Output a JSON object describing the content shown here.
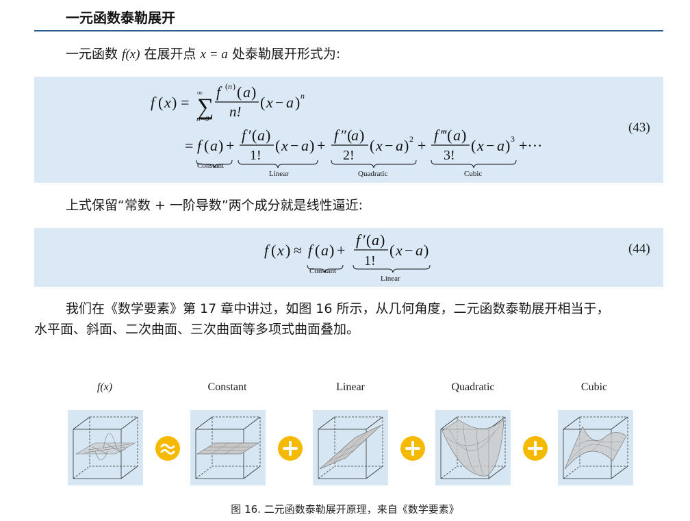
{
  "heading": "一元函数泰勒展开",
  "para1": {
    "before": "一元函数 ",
    "fx": "f(x)",
    "middle": " 在展开点 ",
    "xa": "x = a",
    "after": " 处泰勒展开形式为:"
  },
  "eq43": {
    "number": "(43)",
    "sum_top": "∞",
    "sum_bottom": "n=0",
    "underbrace_labels": [
      "Constant",
      "Linear",
      "Quadratic",
      "Cubic"
    ]
  },
  "para2": "上式保留“常数 + 一阶导数”两个成分就是线性逼近:",
  "eq44": {
    "number": "(44)",
    "underbrace_labels": [
      "Constant",
      "Linear"
    ]
  },
  "para3": {
    "line1": "我们在《数学要素》第 17 章中讲过，如图 16 所示，从几何角度，二元函数泰勒展开相当于，",
    "line2": "水平面、斜面、二次曲面、三次曲面等多项式曲面叠加。"
  },
  "figure": {
    "labels": [
      "f(x)",
      "Constant",
      "Linear",
      "Quadratic",
      "Cubic"
    ],
    "operators": [
      "approx-icon",
      "plus-icon",
      "plus-icon",
      "plus-icon"
    ],
    "caption": "图 16. 二元函数泰勒展开原理，来自《数学要素》"
  },
  "colors": {
    "rule": "#2b5c8a",
    "eq_background": "#dbe9f6",
    "panel_background": "#d6e7f3",
    "operator": "#f5b900"
  }
}
